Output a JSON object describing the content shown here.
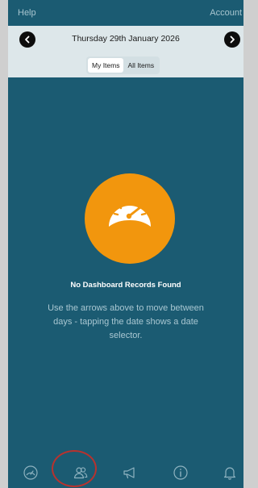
{
  "topbar": {
    "help": "Help",
    "account": "Account"
  },
  "datebar": {
    "date": "Thursday 29th January 2026",
    "filters": [
      {
        "label": "My Items",
        "active": true
      },
      {
        "label": "All Items",
        "active": false
      }
    ]
  },
  "empty_state": {
    "icon": "speedometer-icon",
    "title": "No Dashboard Records Found",
    "description": "Use the arrows above to move between days - tapping the date shows a date selector."
  },
  "tabs": [
    {
      "icon": "dashboard-icon"
    },
    {
      "icon": "contacts-icon",
      "highlighted": true
    },
    {
      "icon": "megaphone-icon"
    },
    {
      "icon": "info-icon"
    },
    {
      "icon": "bell-icon"
    }
  ],
  "colors": {
    "background": "#1b5b72",
    "datebar": "#dde7ea",
    "accent": "#f2960d",
    "annotation": "#b8322e"
  }
}
